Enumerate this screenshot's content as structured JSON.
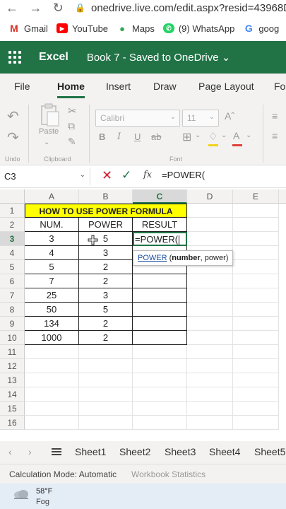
{
  "browser": {
    "url": "onedrive.live.com/edit.aspx?resid=43968D",
    "bookmarks": [
      {
        "label": "Gmail",
        "icon": "gmail-icon",
        "color": "#d93025"
      },
      {
        "label": "YouTube",
        "icon": "youtube-icon",
        "color": "#ff0000"
      },
      {
        "label": "Maps",
        "icon": "maps-icon",
        "color": "#34a853"
      },
      {
        "label": "(9) WhatsApp",
        "icon": "whatsapp-icon",
        "color": "#25d366"
      },
      {
        "label": "goog",
        "icon": "google-icon",
        "color": "#4285f4"
      }
    ]
  },
  "app": {
    "name": "Excel",
    "doc_title": "Book 7  -  Saved to OneDrive ⌄",
    "accent": "#217346"
  },
  "ribbon": {
    "tabs": [
      "File",
      "Home",
      "Insert",
      "Draw",
      "Page Layout",
      "Fo"
    ],
    "active_tab": "Home",
    "font_name": "Calibri",
    "font_size": "11",
    "paste_label": "Paste",
    "group_undo": "Undo",
    "group_clipboard": "Clipboard",
    "group_font": "Font"
  },
  "formula_bar": {
    "name_box": "C3",
    "formula": "=POWER("
  },
  "sheet": {
    "columns": [
      "A",
      "B",
      "C",
      "D",
      "E"
    ],
    "rows": [
      "1",
      "2",
      "3",
      "4",
      "5",
      "6",
      "7",
      "8",
      "9",
      "10",
      "11",
      "12",
      "13",
      "14",
      "15",
      "16"
    ],
    "title": "HOW TO USE POWER FORMULA",
    "headers": [
      "NUM.",
      "POWER",
      "RESULT"
    ],
    "data": [
      [
        "3",
        "5",
        "=POWER("
      ],
      [
        "4",
        "3",
        ""
      ],
      [
        "5",
        "2",
        ""
      ],
      [
        "7",
        "2",
        ""
      ],
      [
        "25",
        "3",
        ""
      ],
      [
        "50",
        "5",
        ""
      ],
      [
        "134",
        "2",
        ""
      ],
      [
        "1000",
        "2",
        ""
      ]
    ],
    "tooltip": {
      "fn": "POWER",
      "arg1": "number",
      "arg2": "power"
    }
  },
  "sheet_tabs": [
    "Sheet1",
    "Sheet2",
    "Sheet3",
    "Sheet4",
    "Sheet5"
  ],
  "status": {
    "mode": "Calculation Mode: Automatic",
    "workbook_stats": "Workbook Statistics"
  },
  "taskbar": {
    "temperature": "58°F",
    "condition": "Fog"
  }
}
